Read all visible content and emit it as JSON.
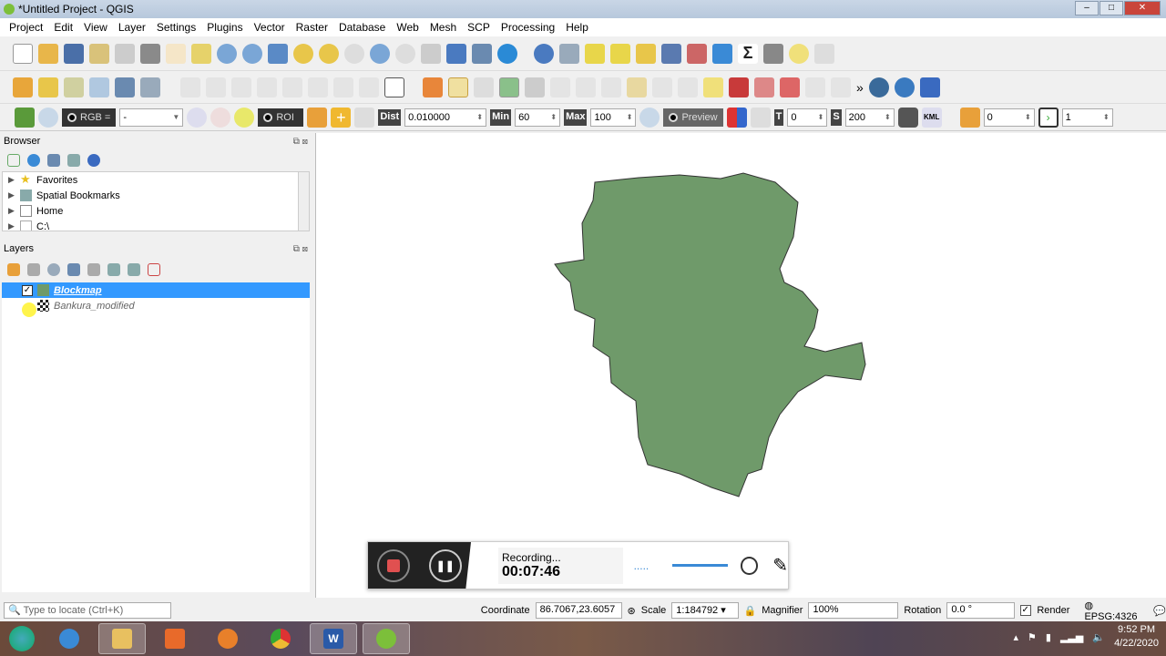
{
  "window": {
    "title": "*Untitled Project - QGIS"
  },
  "menu": [
    "Project",
    "Edit",
    "View",
    "Layer",
    "Settings",
    "Plugins",
    "Vector",
    "Raster",
    "Database",
    "Web",
    "Mesh",
    "SCP",
    "Processing",
    "Help"
  ],
  "scp_toolbar": {
    "rgb_label": "RGB =",
    "rgb_value": "-",
    "roi_label": "ROI",
    "dist_label": "Dist",
    "dist_value": "0.010000",
    "min_label": "Min",
    "min_value": "60",
    "max_label": "Max",
    "max_value": "100",
    "preview_label": "Preview",
    "t_label": "T",
    "t_value": "0",
    "s_label": "S",
    "s_value": "200",
    "kml_label": "KML",
    "band_value": "0",
    "step_value": "1"
  },
  "browser": {
    "title": "Browser",
    "items": [
      {
        "label": "Favorites",
        "icon": "star-icon"
      },
      {
        "label": "Spatial Bookmarks",
        "icon": "bookmark-icon"
      },
      {
        "label": "Home",
        "icon": "home-icon"
      },
      {
        "label": "C:\\",
        "icon": "drive-icon"
      }
    ]
  },
  "layers": {
    "title": "Layers",
    "items": [
      {
        "label": "Blockmap",
        "checked": true,
        "selected": true
      },
      {
        "label": "Bankura_modified",
        "checked": false,
        "selected": false
      }
    ]
  },
  "map": {
    "polygon_fill": "#6f9a6a"
  },
  "recorder": {
    "status": "Recording...",
    "time": "00:07:46"
  },
  "statusbar": {
    "locate_placeholder": "Type to locate (Ctrl+K)",
    "coordinate_label": "Coordinate",
    "coordinate": "86.7067,23.6057",
    "scale_label": "Scale",
    "scale": "1:184792",
    "magnifier_label": "Magnifier",
    "magnifier": "100%",
    "rotation_label": "Rotation",
    "rotation": "0.0 °",
    "render_label": "Render",
    "crs": "EPSG:4326"
  },
  "taskbar": {
    "time": "9:52 PM",
    "date": "4/22/2020"
  }
}
